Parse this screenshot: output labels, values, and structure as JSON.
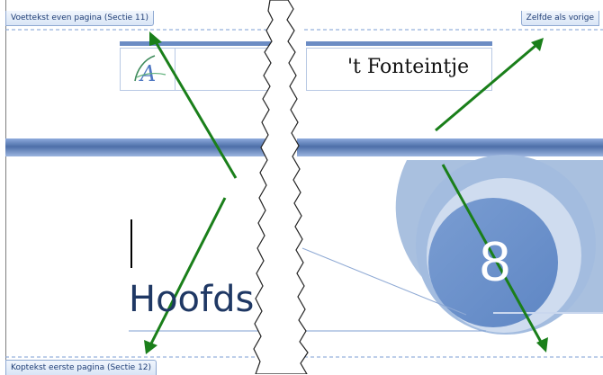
{
  "sections": {
    "footer_even_label": "Voettekst even pagina (Sectie 11)",
    "same_as_previous_label": "Zelfde als vorige",
    "header_first_label": "Koptekst eerste pagina (Sectie 12)"
  },
  "document": {
    "logo_letter": "A",
    "company_name": "'t Fonteintje",
    "page_number": "8",
    "heading": "Hoofds"
  },
  "colors": {
    "arrow": "#1a7f1a",
    "band": "#6b8cc4",
    "circle_outer": "#a9c0df",
    "circle_mid": "#c9d7ee",
    "circle_inner": "#6f95cf",
    "heading": "#1f3864"
  }
}
